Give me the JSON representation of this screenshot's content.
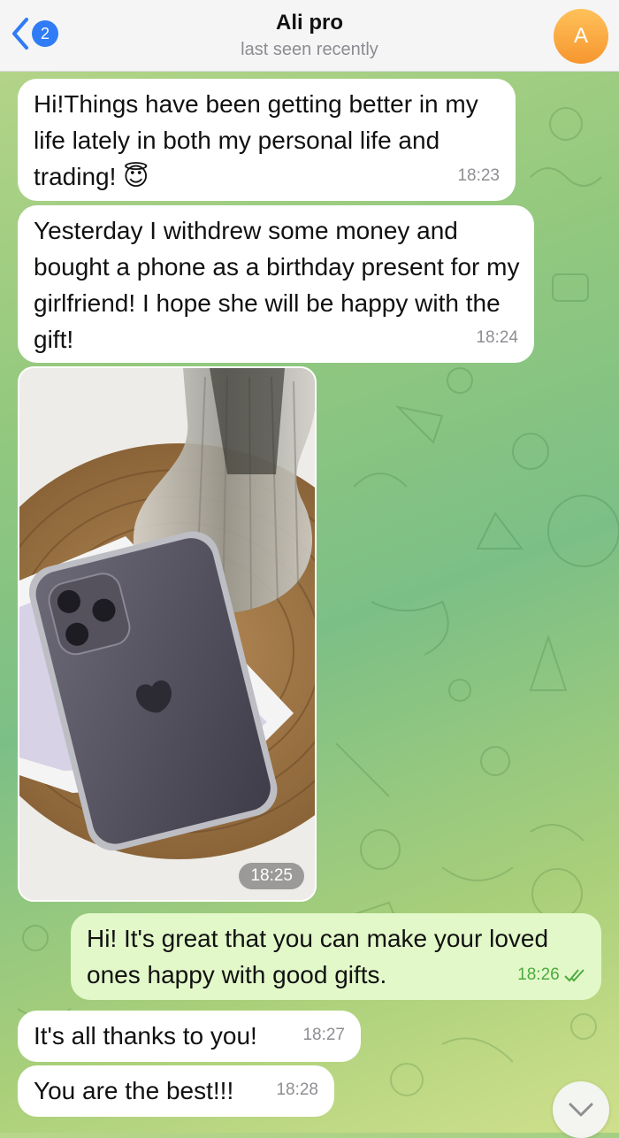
{
  "header": {
    "title": "Ali pro",
    "status": "last seen recently",
    "unread_count": "2",
    "avatar_letter": "A",
    "avatar_color": "#f7962f"
  },
  "messages": [
    {
      "direction": "incoming",
      "text": "Hi!Things have been getting better in my life lately in both my personal life and trading! 😇",
      "time": "18:23"
    },
    {
      "direction": "incoming",
      "text": "Yesterday I withdrew some money and bought a phone as a birthday present for my girlfriend! I hope she will be happy with the gift!",
      "time": "18:24"
    },
    {
      "direction": "incoming",
      "type": "photo",
      "time": "18:25"
    },
    {
      "direction": "outgoing",
      "text": "Hi! It's great that you can make your loved ones happy with good gifts.",
      "time": "18:26",
      "read": true
    },
    {
      "direction": "incoming",
      "text": "It's all thanks to you!",
      "time": "18:27"
    },
    {
      "direction": "incoming",
      "text": "You are the best!!!",
      "time": "18:28"
    }
  ],
  "colors": {
    "incoming_bubble": "#ffffff",
    "outgoing_bubble": "#e2f8c9",
    "accent": "#2f7cf6",
    "read_check": "#4eaa3f"
  }
}
